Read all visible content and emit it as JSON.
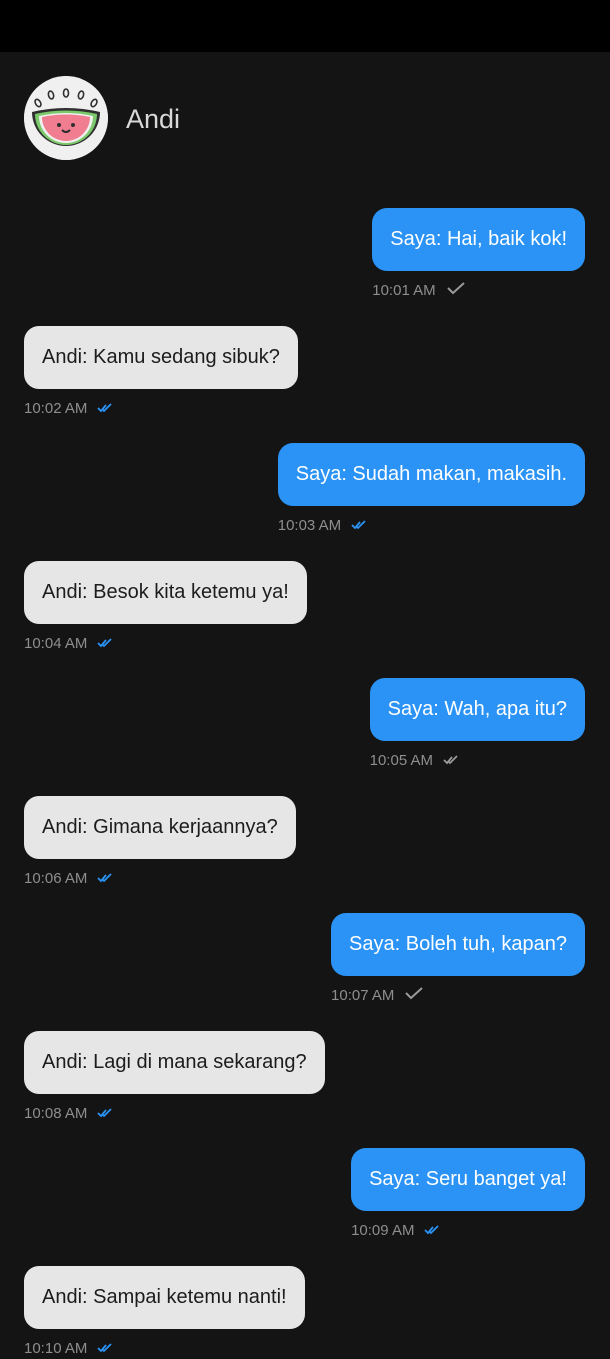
{
  "contact": {
    "name": "Andi"
  },
  "messages": [
    {
      "dir": "out",
      "text": "Saya: Hai, baik kok!",
      "time": "10:01 AM",
      "status": "sent"
    },
    {
      "dir": "in",
      "text": "Andi: Kamu sedang sibuk?",
      "time": "10:02 AM",
      "status": "read"
    },
    {
      "dir": "out",
      "text": "Saya: Sudah makan, makasih.",
      "time": "10:03 AM",
      "status": "read"
    },
    {
      "dir": "in",
      "text": "Andi: Besok kita ketemu ya!",
      "time": "10:04 AM",
      "status": "read"
    },
    {
      "dir": "out",
      "text": "Saya: Wah, apa itu?",
      "time": "10:05 AM",
      "status": "delivered"
    },
    {
      "dir": "in",
      "text": "Andi: Gimana kerjaannya?",
      "time": "10:06 AM",
      "status": "read"
    },
    {
      "dir": "out",
      "text": "Saya: Boleh tuh, kapan?",
      "time": "10:07 AM",
      "status": "sent"
    },
    {
      "dir": "in",
      "text": "Andi: Lagi di mana sekarang?",
      "time": "10:08 AM",
      "status": "read"
    },
    {
      "dir": "out",
      "text": "Saya: Seru banget ya!",
      "time": "10:09 AM",
      "status": "read"
    },
    {
      "dir": "in",
      "text": "Andi: Sampai ketemu nanti!",
      "time": "10:10 AM",
      "status": "read"
    }
  ],
  "colors": {
    "background": "#141414",
    "incoming_bubble": "#e6e6e6",
    "outgoing_bubble": "#2a93f5",
    "read_tick": "#2a93f5",
    "sent_tick": "#9a9a9a"
  }
}
